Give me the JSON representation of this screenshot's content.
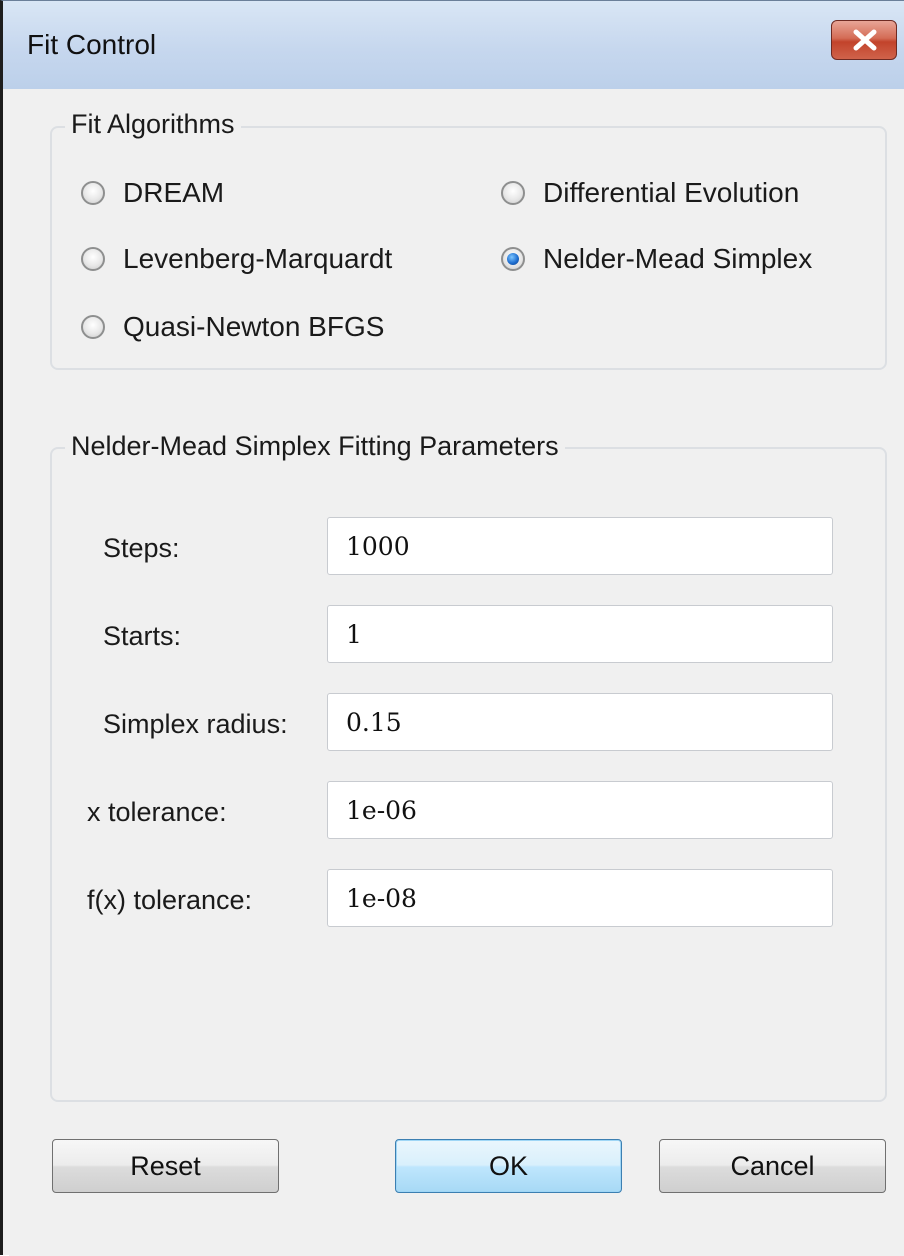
{
  "window": {
    "title": "Fit Control"
  },
  "algorithms": {
    "title": "Fit Algorithms",
    "options": [
      {
        "label": "DREAM",
        "checked": false
      },
      {
        "label": "Differential Evolution",
        "checked": false
      },
      {
        "label": "Levenberg-Marquardt",
        "checked": false
      },
      {
        "label": "Nelder-Mead Simplex",
        "checked": true
      },
      {
        "label": "Quasi-Newton BFGS",
        "checked": false
      }
    ]
  },
  "parameters": {
    "title": "Nelder-Mead Simplex Fitting Parameters",
    "fields": [
      {
        "label": "Steps:",
        "value": "1000"
      },
      {
        "label": "Starts:",
        "value": "1"
      },
      {
        "label": "Simplex radius:",
        "value": "0.15"
      },
      {
        "label": "x tolerance:",
        "value": "1e-06"
      },
      {
        "label": "f(x) tolerance:",
        "value": "1e-08"
      }
    ]
  },
  "buttons": {
    "reset": "Reset",
    "ok": "OK",
    "cancel": "Cancel"
  },
  "icons": {
    "close": "close-icon"
  },
  "colors": {
    "close_button": "#c2432b",
    "selected_radio": "#1f6fd1",
    "titlebar": "#c6d7ee"
  }
}
